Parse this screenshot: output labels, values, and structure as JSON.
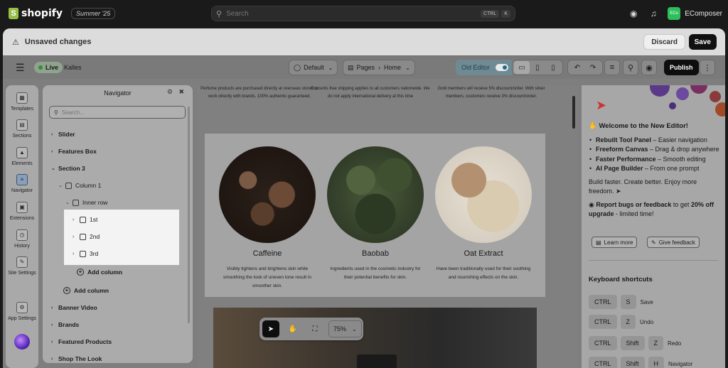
{
  "topbar": {
    "logo_text": "shopify",
    "edition": "Summer '25",
    "search_placeholder": "Search",
    "kbd_ctrl": "CTRL",
    "kbd_k": "K",
    "account_initials": "ECo",
    "account_name": "EComposer"
  },
  "unsaved": {
    "label": "Unsaved changes",
    "discard": "Discard",
    "save": "Save"
  },
  "toolbar": {
    "live": "Live",
    "store": "Kalles",
    "theme": "Default",
    "pages": "Pages",
    "page": "Home",
    "old_editor": "Old Editor",
    "publish": "Publish"
  },
  "rail": {
    "items": [
      {
        "label": "Templates"
      },
      {
        "label": "Sections"
      },
      {
        "label": "Elements"
      },
      {
        "label": "Navigator"
      },
      {
        "label": "Extensions"
      },
      {
        "label": "History"
      },
      {
        "label": "Site Settings"
      },
      {
        "label": "App Settings"
      }
    ]
  },
  "navigator": {
    "title": "Navigator",
    "search_placeholder": "Search...",
    "rows": [
      {
        "label": "Slider"
      },
      {
        "label": "Features Box"
      },
      {
        "label": "Section 3"
      },
      {
        "label": "Column 1"
      },
      {
        "label": "Inner row"
      },
      {
        "label": "1st"
      },
      {
        "label": "2nd"
      },
      {
        "label": "3rd"
      },
      {
        "label": "Add column"
      },
      {
        "label": "Add column"
      },
      {
        "label": "Banner Video"
      },
      {
        "label": "Brands"
      },
      {
        "label": "Featured Products"
      },
      {
        "label": "Shop The Look"
      }
    ]
  },
  "canvas": {
    "promo": [
      "Perfume products are purchased directly at overseas stores or work directly with brands, 100% authentic guaranteed.",
      "Esscents free shipping applies to all customers nationwide. We do not apply international delivery at this time",
      "Gold members will receive 5% discount/order. With silver members, customers receive 3% discount/order."
    ],
    "features": [
      {
        "title": "Caffeine",
        "desc": "Visibly tightens and brightens skin while smoothing the look of uneven tone result in smoother skin."
      },
      {
        "title": "Baobab",
        "desc": "Ingredients used in the cosmetic industry for their potential benefits for skin."
      },
      {
        "title": "Oat Extract",
        "desc": "Have been traditionally used for their soothing and nourishing effects on the skin."
      }
    ],
    "zoom": "75%"
  },
  "right_panel": {
    "welcome_title": "Welcome to the New Editor!",
    "bullets": [
      {
        "bold": "Rebuilt Tool Panel",
        "rest": " – Easier navigation"
      },
      {
        "bold": "Freeform Canvas",
        "rest": " – Drag & drop anywhere"
      },
      {
        "bold": "Faster Performance",
        "rest": " – Smooth editing"
      },
      {
        "bold": "AI Page Builder",
        "rest": " – From one prompt"
      }
    ],
    "tagline": "Build faster. Create better. Enjoy more freedom.",
    "bug_bold": "Report bugs or feedback",
    "bug_mid": " to get ",
    "bug_bold2": "20% off upgrade",
    "bug_rest": " - limited time!",
    "learn_more": "Learn more",
    "give_feedback": "Give feedback",
    "shortcuts_title": "Keyboard shortcuts",
    "shortcuts": [
      {
        "keys": [
          "CTRL",
          "S"
        ],
        "action": "Save"
      },
      {
        "keys": [
          "CTRL",
          "Z"
        ],
        "action": "Undo"
      },
      {
        "keys": [
          "CTRL",
          "Shift",
          "Z"
        ],
        "action": "Redo"
      },
      {
        "keys": [
          "CTRL",
          "Shift",
          "H"
        ],
        "action": "Navigator"
      }
    ]
  }
}
